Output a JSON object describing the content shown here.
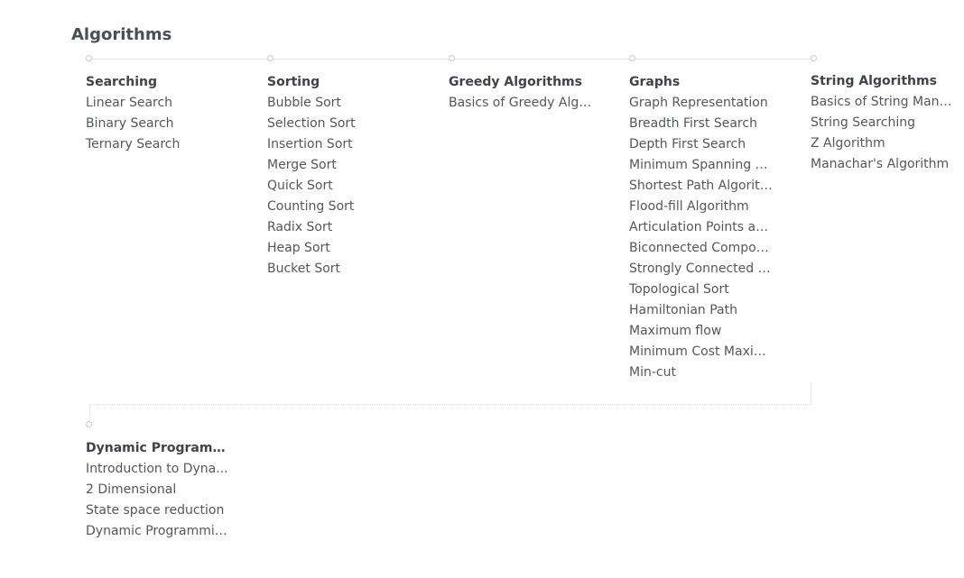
{
  "page": {
    "title": "Algorithms"
  },
  "topics": [
    {
      "title": "Searching",
      "items": [
        "Linear Search",
        "Binary Search",
        "Ternary Search"
      ]
    },
    {
      "title": "Sorting",
      "items": [
        "Bubble Sort",
        "Selection Sort",
        "Insertion Sort",
        "Merge Sort",
        "Quick Sort",
        "Counting Sort",
        "Radix Sort",
        "Heap Sort",
        "Bucket Sort"
      ]
    },
    {
      "title": "Greedy Algorithms",
      "items": [
        "Basics of Greedy Algor..."
      ]
    },
    {
      "title": "Graphs",
      "items": [
        "Graph Representation",
        "Breadth First Search",
        "Depth First Search",
        "Minimum Spanning Tr...",
        "Shortest Path Algorith...",
        "Flood-fill Algorithm",
        "Articulation Points an...",
        "Biconnected Compon...",
        "Strongly Connected C...",
        "Topological Sort",
        "Hamiltonian Path",
        "Maximum flow",
        "Minimum Cost Maxim...",
        "Min-cut"
      ]
    },
    {
      "title": "String Algorithms",
      "items": [
        "Basics of String Manip...",
        "String Searching",
        "Z Algorithm",
        "Manachar's Algorithm"
      ]
    },
    {
      "title": "Dynamic Programmi...",
      "items": [
        "Introduction to Dyna...",
        "2 Dimensional",
        "State space reduction",
        "Dynamic Programmin..."
      ]
    }
  ]
}
